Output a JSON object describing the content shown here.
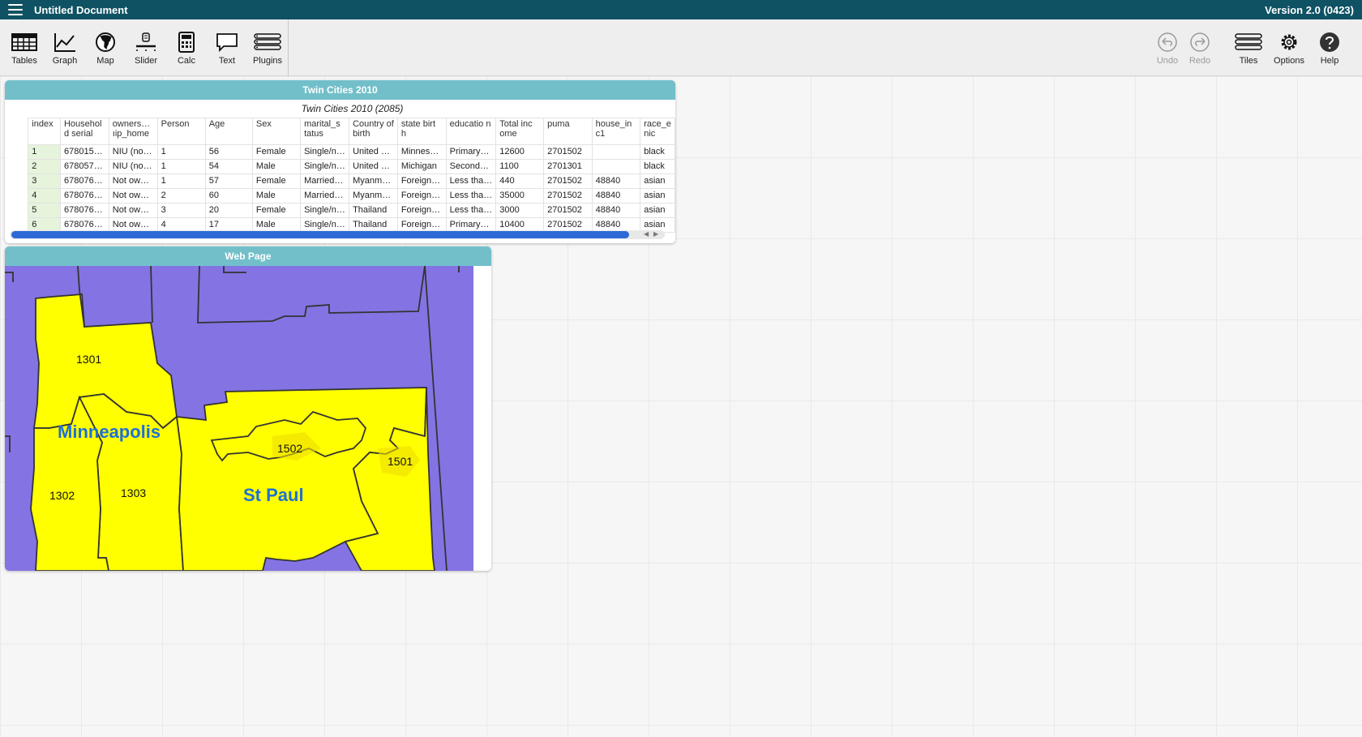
{
  "app": {
    "title": "Untitled Document",
    "version": "Version 2.0 (0423)"
  },
  "toolbar": {
    "tools": [
      {
        "label": "Tables",
        "icon": "table-icon"
      },
      {
        "label": "Graph",
        "icon": "graph-icon"
      },
      {
        "label": "Map",
        "icon": "globe-icon"
      },
      {
        "label": "Slider",
        "icon": "slider-icon"
      },
      {
        "label": "Calc",
        "icon": "calculator-icon"
      },
      {
        "label": "Text",
        "icon": "text-bubble-icon"
      },
      {
        "label": "Plugins",
        "icon": "plugins-icon"
      }
    ],
    "right": [
      {
        "label": "Undo",
        "icon": "undo-icon"
      },
      {
        "label": "Redo",
        "icon": "redo-icon"
      },
      {
        "label": "Tiles",
        "icon": "tiles-icon"
      },
      {
        "label": "Options",
        "icon": "gear-icon"
      },
      {
        "label": "Help",
        "icon": "help-icon"
      }
    ]
  },
  "table_tile": {
    "title": "Twin Cities 2010",
    "caption": "Twin Cities 2010 (2085)",
    "columns": [
      "index",
      "Household serial",
      "ownership_home",
      "Person",
      "Age",
      "Sex",
      "marital_status",
      "Country of birth",
      "state birth",
      "education",
      "Total income",
      "puma",
      "house_inc1",
      "race_ethnic"
    ],
    "column_display": [
      "index",
      "Househol d serial",
      "owners… ıip_home",
      "Person",
      "Age",
      "Sex",
      "marital_s tatus",
      "Country of birth",
      "state birt h",
      "educatio n",
      "Total inc ome",
      "puma",
      "house_in c1",
      "race_e nic"
    ],
    "rows": [
      [
        "1",
        "678015…",
        "NIU (no…",
        "1",
        "56",
        "Female",
        "Single/n…",
        "United …",
        "Minnes…",
        "Primary…",
        "12600",
        "2701502",
        "",
        "black"
      ],
      [
        "2",
        "678057…",
        "NIU (no…",
        "1",
        "54",
        "Male",
        "Single/n…",
        "United …",
        "Michigan",
        "Second…",
        "1100",
        "2701301",
        "",
        "black"
      ],
      [
        "3",
        "678076…",
        "Not ow…",
        "1",
        "57",
        "Female",
        "Married…",
        "Myanm…",
        "Foreign…",
        "Less tha…",
        "440",
        "2701502",
        "48840",
        "asian"
      ],
      [
        "4",
        "678076…",
        "Not ow…",
        "2",
        "60",
        "Male",
        "Married…",
        "Myanm…",
        "Foreign…",
        "Less tha…",
        "35000",
        "2701502",
        "48840",
        "asian"
      ],
      [
        "5",
        "678076…",
        "Not ow…",
        "3",
        "20",
        "Female",
        "Single/n…",
        "Thailand",
        "Foreign…",
        "Less tha…",
        "3000",
        "2701502",
        "48840",
        "asian"
      ],
      [
        "6",
        "678076…",
        "Not ow…",
        "4",
        "17",
        "Male",
        "Single/n…",
        "Thailand",
        "Foreign…",
        "Primary…",
        "10400",
        "2701502",
        "48840",
        "asian"
      ]
    ]
  },
  "web_tile": {
    "title": "Web Page",
    "map": {
      "colors": {
        "region": "#ffff00",
        "background": "#8473e2",
        "city_label": "#1f6fd6",
        "border": "#333333"
      },
      "labels": {
        "puma_1301": "1301",
        "puma_1302": "1302",
        "puma_1303": "1303",
        "puma_1501": "1501",
        "puma_1502": "1502",
        "city_minneapolis": "Minneapolis",
        "city_stpaul": "St Paul"
      }
    }
  }
}
